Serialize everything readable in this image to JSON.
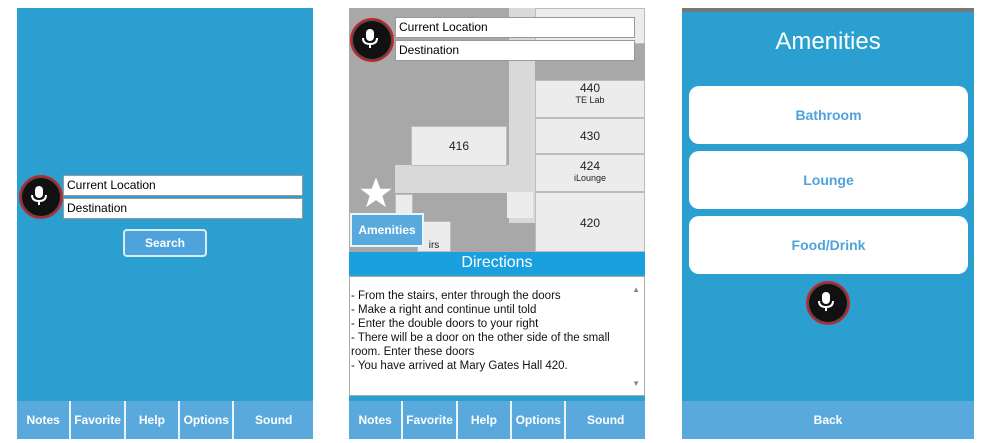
{
  "screen_search": {
    "current_location_placeholder": "Current Location",
    "destination_placeholder": "Destination",
    "search_label": "Search"
  },
  "screen_directions": {
    "current_location_placeholder": "Current Location",
    "destination_placeholder": "Destination",
    "rooms": {
      "r440": "440",
      "r440_sub": "TE Lab",
      "r430": "430",
      "r416": "416",
      "r424": "424",
      "r424_sub": "iLounge",
      "r420": "420",
      "r_stairs": "irs"
    },
    "amenities_label": "Amenities",
    "directions_title": "Directions",
    "directions_lines": [
      "- From the stairs, enter through the doors",
      "- Make a right and continue until told",
      "- Enter the double doors to your right",
      "- There will be a door on the other side of the small room. Enter these doors",
      "- You have arrived at Mary Gates Hall 420."
    ]
  },
  "screen_amenities": {
    "title": "Amenities",
    "options": [
      "Bathroom",
      "Lounge",
      "Food/Drink"
    ],
    "back_label": "Back"
  },
  "tabbar": [
    "Notes",
    "Favorite",
    "Help",
    "Options",
    "Sound"
  ],
  "colors": {
    "background": "#2b9fcf",
    "tab": "#5aa9dd",
    "mic_ring": "#c0272d"
  },
  "icons": {
    "mic": "microphone-icon",
    "star": "star-icon"
  }
}
